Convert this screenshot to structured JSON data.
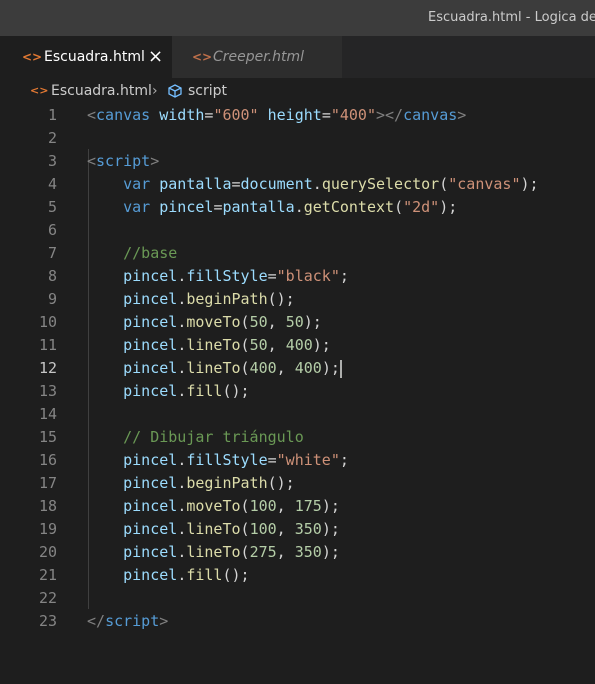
{
  "window": {
    "title": "Escuadra.html - Logica de"
  },
  "tabs": [
    {
      "label": "Escuadra.html",
      "active": true,
      "close": "×"
    },
    {
      "label": "Creeper.html",
      "active": false
    }
  ],
  "breadcrumb": {
    "file": "Escuadra.html",
    "separator": "›",
    "symbol": "script"
  },
  "editor": {
    "current_line": 12,
    "line_numbers": [
      "1",
      "2",
      "3",
      "4",
      "5",
      "6",
      "7",
      "8",
      "9",
      "10",
      "11",
      "12",
      "13",
      "14",
      "15",
      "16",
      "17",
      "18",
      "19",
      "20",
      "21",
      "22",
      "23"
    ],
    "lines": [
      [
        [
          "punc",
          "<"
        ],
        [
          "tag",
          "canvas"
        ],
        [
          "op",
          " "
        ],
        [
          "attr",
          "width"
        ],
        [
          "op",
          "="
        ],
        [
          "str",
          "\"600\""
        ],
        [
          "op",
          " "
        ],
        [
          "attr",
          "height"
        ],
        [
          "op",
          "="
        ],
        [
          "str",
          "\"400\""
        ],
        [
          "punc",
          "></"
        ],
        [
          "tag",
          "canvas"
        ],
        [
          "punc",
          ">"
        ]
      ],
      [],
      [
        [
          "punc",
          "<"
        ],
        [
          "tag",
          "script"
        ],
        [
          "punc",
          ">"
        ]
      ],
      [
        [
          "op",
          "    "
        ],
        [
          "kw",
          "var"
        ],
        [
          "op",
          " "
        ],
        [
          "var",
          "pantalla"
        ],
        [
          "op",
          "="
        ],
        [
          "var",
          "document"
        ],
        [
          "op",
          "."
        ],
        [
          "fn",
          "querySelector"
        ],
        [
          "op",
          "("
        ],
        [
          "str",
          "\"canvas\""
        ],
        [
          "op",
          ");"
        ]
      ],
      [
        [
          "op",
          "    "
        ],
        [
          "kw",
          "var"
        ],
        [
          "op",
          " "
        ],
        [
          "var",
          "pincel"
        ],
        [
          "op",
          "="
        ],
        [
          "var",
          "pantalla"
        ],
        [
          "op",
          "."
        ],
        [
          "fn",
          "getContext"
        ],
        [
          "op",
          "("
        ],
        [
          "str",
          "\"2d\""
        ],
        [
          "op",
          ");"
        ]
      ],
      [],
      [
        [
          "op",
          "    "
        ],
        [
          "com",
          "//base"
        ]
      ],
      [
        [
          "op",
          "    "
        ],
        [
          "var",
          "pincel"
        ],
        [
          "op",
          "."
        ],
        [
          "var",
          "fillStyle"
        ],
        [
          "op",
          "="
        ],
        [
          "str",
          "\"black\""
        ],
        [
          "op",
          ";"
        ]
      ],
      [
        [
          "op",
          "    "
        ],
        [
          "var",
          "pincel"
        ],
        [
          "op",
          "."
        ],
        [
          "fn",
          "beginPath"
        ],
        [
          "op",
          "();"
        ]
      ],
      [
        [
          "op",
          "    "
        ],
        [
          "var",
          "pincel"
        ],
        [
          "op",
          "."
        ],
        [
          "fn",
          "moveTo"
        ],
        [
          "op",
          "("
        ],
        [
          "num",
          "50"
        ],
        [
          "op",
          ", "
        ],
        [
          "num",
          "50"
        ],
        [
          "op",
          ");"
        ]
      ],
      [
        [
          "op",
          "    "
        ],
        [
          "var",
          "pincel"
        ],
        [
          "op",
          "."
        ],
        [
          "fn",
          "lineTo"
        ],
        [
          "op",
          "("
        ],
        [
          "num",
          "50"
        ],
        [
          "op",
          ", "
        ],
        [
          "num",
          "400"
        ],
        [
          "op",
          ");"
        ]
      ],
      [
        [
          "op",
          "    "
        ],
        [
          "var",
          "pincel"
        ],
        [
          "op",
          "."
        ],
        [
          "fn",
          "lineTo"
        ],
        [
          "op",
          "("
        ],
        [
          "num",
          "400"
        ],
        [
          "op",
          ", "
        ],
        [
          "num",
          "400"
        ],
        [
          "op",
          ");"
        ]
      ],
      [
        [
          "op",
          "    "
        ],
        [
          "var",
          "pincel"
        ],
        [
          "op",
          "."
        ],
        [
          "fn",
          "fill"
        ],
        [
          "op",
          "();"
        ]
      ],
      [],
      [
        [
          "op",
          "    "
        ],
        [
          "com",
          "// Dibujar triángulo"
        ]
      ],
      [
        [
          "op",
          "    "
        ],
        [
          "var",
          "pincel"
        ],
        [
          "op",
          "."
        ],
        [
          "var",
          "fillStyle"
        ],
        [
          "op",
          "="
        ],
        [
          "str",
          "\"white\""
        ],
        [
          "op",
          ";"
        ]
      ],
      [
        [
          "op",
          "    "
        ],
        [
          "var",
          "pincel"
        ],
        [
          "op",
          "."
        ],
        [
          "fn",
          "beginPath"
        ],
        [
          "op",
          "();"
        ]
      ],
      [
        [
          "op",
          "    "
        ],
        [
          "var",
          "pincel"
        ],
        [
          "op",
          "."
        ],
        [
          "fn",
          "moveTo"
        ],
        [
          "op",
          "("
        ],
        [
          "num",
          "100"
        ],
        [
          "op",
          ", "
        ],
        [
          "num",
          "175"
        ],
        [
          "op",
          ");"
        ]
      ],
      [
        [
          "op",
          "    "
        ],
        [
          "var",
          "pincel"
        ],
        [
          "op",
          "."
        ],
        [
          "fn",
          "lineTo"
        ],
        [
          "op",
          "("
        ],
        [
          "num",
          "100"
        ],
        [
          "op",
          ", "
        ],
        [
          "num",
          "350"
        ],
        [
          "op",
          ");"
        ]
      ],
      [
        [
          "op",
          "    "
        ],
        [
          "var",
          "pincel"
        ],
        [
          "op",
          "."
        ],
        [
          "fn",
          "lineTo"
        ],
        [
          "op",
          "("
        ],
        [
          "num",
          "275"
        ],
        [
          "op",
          ", "
        ],
        [
          "num",
          "350"
        ],
        [
          "op",
          ");"
        ]
      ],
      [
        [
          "op",
          "    "
        ],
        [
          "var",
          "pincel"
        ],
        [
          "op",
          "."
        ],
        [
          "fn",
          "fill"
        ],
        [
          "op",
          "();"
        ]
      ],
      [],
      [
        [
          "punc",
          "</"
        ],
        [
          "tag",
          "script"
        ],
        [
          "punc",
          ">"
        ]
      ]
    ]
  },
  "colors": {
    "background": "#1e1e1e",
    "titlebar": "#3c3c3c",
    "tabbar": "#252526",
    "tag": "#569cd6",
    "string": "#ce9178",
    "function": "#dcdcaa",
    "variable": "#9cdcfe",
    "number": "#b5cea8",
    "comment": "#6a9955"
  },
  "icons": {
    "tab_file": "html-file-icon",
    "breadcrumb_file": "html-file-icon",
    "breadcrumb_symbol": "cube-symbol-icon",
    "tab_close": "close-icon"
  }
}
